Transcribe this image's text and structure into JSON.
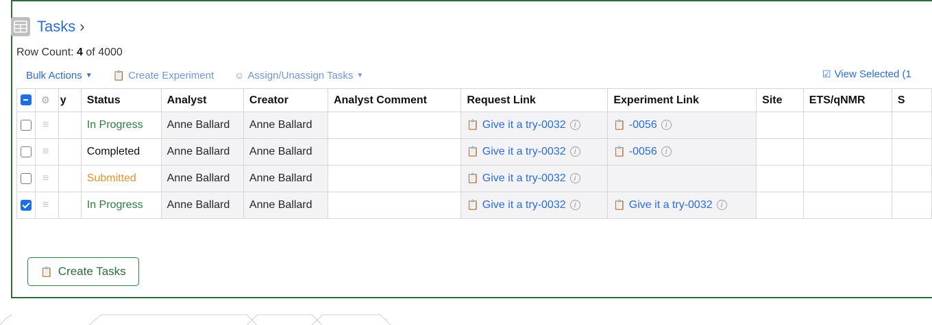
{
  "title": "Tasks",
  "row_count": {
    "label": "Row Count:",
    "shown": "4",
    "of_total": "of 4000"
  },
  "toolbar": {
    "bulk_actions": "Bulk Actions",
    "create_experiment": "Create Experiment",
    "assign_unassign": "Assign/Unassign Tasks",
    "view_selected": "View Selected (1"
  },
  "columns": [
    "y",
    "Status",
    "Analyst",
    "Creator",
    "Analyst Comment",
    "Request Link",
    "Experiment Link",
    "Site",
    "ETS/qNMR",
    "S"
  ],
  "rows": [
    {
      "checked": false,
      "status": "In Progress",
      "status_kind": "progress",
      "analyst": "Anne Ballard",
      "creator": "Anne Ballard",
      "comment": "",
      "request": "Give it a try-0032",
      "experiment": "-0056",
      "site": "",
      "ets": ""
    },
    {
      "checked": false,
      "status": "Completed",
      "status_kind": "completed",
      "analyst": "Anne Ballard",
      "creator": "Anne Ballard",
      "comment": "",
      "request": "Give it a try-0032",
      "experiment": "-0056",
      "site": "",
      "ets": ""
    },
    {
      "checked": false,
      "status": "Submitted",
      "status_kind": "submitted",
      "analyst": "Anne Ballard",
      "creator": "Anne Ballard",
      "comment": "",
      "request": "Give it a try-0032",
      "experiment": "",
      "site": "",
      "ets": ""
    },
    {
      "checked": true,
      "status": "In Progress",
      "status_kind": "progress",
      "analyst": "Anne Ballard",
      "creator": "Anne Ballard",
      "comment": "",
      "request": "Give it a try-0032",
      "experiment": "Give it a try-0032",
      "site": "",
      "ets": ""
    }
  ],
  "create_tasks_label": "Create Tasks",
  "colors": {
    "accent": "#2b6cd4",
    "border_green": "#2e6b3a",
    "in_progress": "#2d7a3e",
    "submitted": "#e8902f"
  }
}
